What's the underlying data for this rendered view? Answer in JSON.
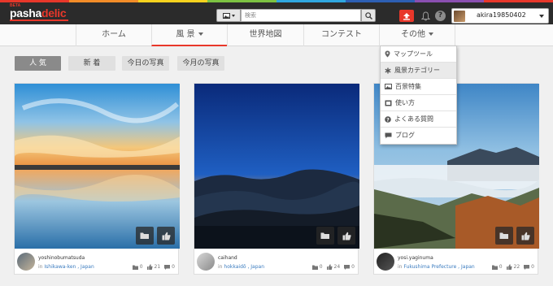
{
  "brand": {
    "beta": "BETA",
    "name_part1": "pasha",
    "name_part2": "delic",
    "rainbow_colors": [
      "#e8372a",
      "#f28c28",
      "#f7d21e",
      "#7cc242",
      "#2fa7df",
      "#2d5fb3",
      "#8a4fb0",
      "#e8372a"
    ]
  },
  "header": {
    "search_placeholder": "検索",
    "username": "akira19850402"
  },
  "nav": {
    "items": [
      {
        "label": "ホーム"
      },
      {
        "label": "風 景"
      },
      {
        "label": "世界地図"
      },
      {
        "label": "コンテスト"
      },
      {
        "label": "その他"
      }
    ]
  },
  "filters": {
    "tabs": [
      "人 気",
      "新 着",
      "今日の写真",
      "今月の写真"
    ]
  },
  "dropdown": {
    "items": [
      {
        "label": "マップツール",
        "icon": "map-marker-icon"
      },
      {
        "label": "風景カテゴリー",
        "icon": "asterisk-icon"
      },
      {
        "label": "百景特集",
        "icon": "picture-icon"
      },
      {
        "label": "使い方",
        "icon": "book-icon"
      },
      {
        "label": "よくある質問",
        "icon": "question-icon"
      },
      {
        "label": "ブログ",
        "icon": "chat-icon"
      }
    ]
  },
  "cards": [
    {
      "user": "yoshinobumatsuda",
      "in": "in",
      "location": "Ishikawa-ken , Japan",
      "folders": "0",
      "likes": "21",
      "comments": "0"
    },
    {
      "user": "caihand",
      "in": "in",
      "location": "hokkaidō , Japan",
      "folders": "0",
      "likes": "24",
      "comments": "0"
    },
    {
      "user": "yosi.yaginuma",
      "in": "in",
      "location": "Fukushima Prefecture , Japan",
      "folders": "0",
      "likes": "22",
      "comments": "0"
    }
  ]
}
